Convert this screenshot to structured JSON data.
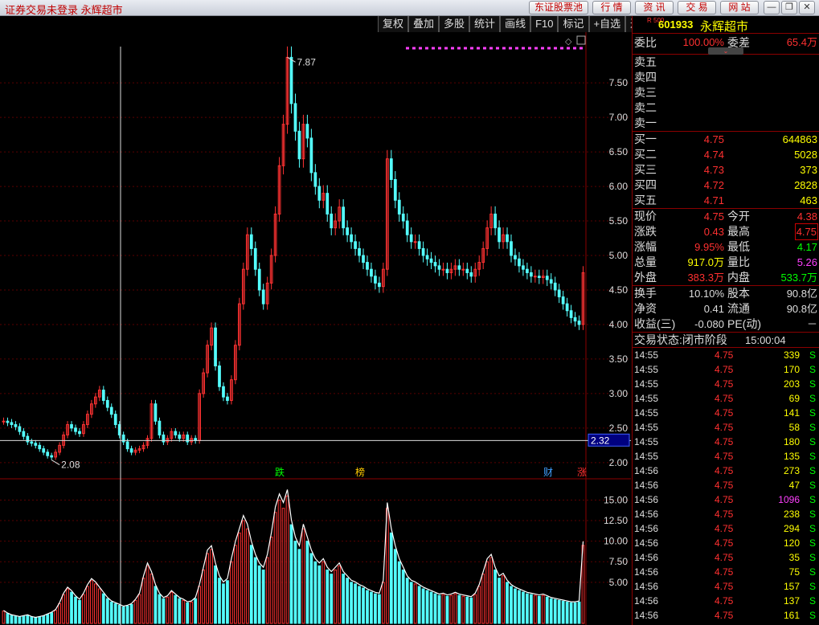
{
  "window": {
    "title": "证券交易未登录  永辉超市",
    "buttons": [
      "东证股票池",
      "行 情",
      "资 讯",
      "交 易",
      "网 站"
    ]
  },
  "toolbar": {
    "items": [
      "复权",
      "叠加",
      "多股",
      "统计",
      "画线",
      "F10",
      "标记",
      "+自选",
      "返回"
    ]
  },
  "chart": {
    "price_ticks": [
      "7.50",
      "7.00",
      "6.50",
      "6.00",
      "5.50",
      "5.00",
      "4.50",
      "4.00",
      "3.50",
      "3.00",
      "2.50",
      "2.00"
    ],
    "volume_ticks": [
      "15.00",
      "12.50",
      "10.00",
      "7.50",
      "5.00"
    ],
    "high_label": "7.87",
    "low_label": "2.08",
    "cursor_price": "2.32",
    "markers": [
      {
        "text": "跌",
        "color": "#00ff00"
      },
      {
        "text": "榜",
        "color": "#ffcc00"
      },
      {
        "text": "财",
        "color": "#40a0ff"
      },
      {
        "text": "涨",
        "color": "#ff3030"
      }
    ]
  },
  "chart_data": {
    "type": "candlestick",
    "ylim": [
      1.8,
      8.2
    ],
    "close": [
      2.6,
      2.58,
      2.55,
      2.52,
      2.45,
      2.38,
      2.3,
      2.28,
      2.25,
      2.2,
      2.15,
      2.1,
      2.08,
      2.15,
      2.25,
      2.4,
      2.55,
      2.5,
      2.45,
      2.42,
      2.55,
      2.7,
      2.85,
      2.95,
      3.05,
      2.9,
      2.8,
      2.7,
      2.55,
      2.4,
      2.3,
      2.2,
      2.15,
      2.18,
      2.2,
      2.25,
      2.35,
      2.85,
      2.6,
      2.4,
      2.3,
      2.35,
      2.45,
      2.4,
      2.35,
      2.4,
      2.3,
      2.35,
      2.32,
      3.0,
      3.3,
      3.7,
      3.95,
      3.4,
      3.1,
      2.95,
      2.9,
      3.2,
      3.7,
      4.3,
      4.8,
      5.3,
      5.1,
      4.8,
      4.5,
      4.3,
      4.6,
      5.0,
      5.6,
      6.3,
      6.9,
      7.87,
      7.2,
      6.8,
      6.4,
      6.9,
      6.7,
      6.2,
      6.0,
      5.8,
      5.9,
      5.6,
      5.4,
      5.5,
      5.7,
      5.4,
      5.3,
      5.2,
      5.1,
      5.0,
      4.9,
      4.8,
      4.7,
      4.6,
      4.55,
      4.8,
      6.4,
      6.1,
      5.8,
      5.6,
      5.5,
      5.3,
      5.2,
      5.2,
      5.1,
      5.0,
      4.95,
      4.9,
      4.85,
      4.8,
      4.8,
      4.75,
      4.8,
      4.85,
      4.8,
      4.8,
      4.75,
      4.7,
      4.8,
      4.9,
      5.1,
      5.4,
      5.6,
      5.4,
      5.2,
      5.3,
      5.2,
      5.0,
      4.95,
      4.85,
      4.8,
      4.75,
      4.7,
      4.7,
      4.68,
      4.7,
      4.65,
      4.6,
      4.5,
      4.4,
      4.3,
      4.2,
      4.1,
      4.05,
      4.0,
      4.75
    ],
    "volume": [
      1.5,
      1.2,
      1.0,
      0.9,
      0.8,
      0.9,
      1.0,
      0.8,
      0.7,
      0.8,
      0.9,
      1.1,
      1.3,
      1.6,
      2.4,
      3.5,
      4.2,
      3.8,
      3.2,
      2.8,
      3.5,
      4.5,
      5.2,
      4.8,
      4.2,
      3.6,
      3.0,
      2.6,
      2.4,
      2.2,
      2.0,
      2.1,
      2.3,
      2.8,
      3.5,
      5.5,
      7.0,
      6.0,
      4.5,
      3.5,
      3.0,
      3.2,
      3.8,
      3.4,
      3.0,
      2.8,
      2.5,
      2.6,
      3.0,
      4.5,
      6.5,
      8.5,
      9.0,
      7.0,
      5.5,
      4.8,
      5.2,
      7.5,
      9.5,
      11.0,
      12.5,
      11.5,
      9.5,
      8.0,
      7.0,
      6.5,
      8.0,
      10.5,
      13.5,
      15.0,
      14.0,
      15.5,
      12.0,
      10.0,
      9.0,
      11.5,
      10.0,
      8.5,
      7.5,
      7.0,
      7.5,
      6.5,
      6.0,
      6.5,
      7.0,
      6.0,
      5.5,
      5.0,
      4.8,
      4.5,
      4.3,
      4.0,
      3.8,
      3.6,
      3.5,
      5.0,
      14.0,
      11.0,
      9.0,
      7.5,
      6.5,
      5.5,
      5.0,
      4.8,
      4.5,
      4.2,
      4.0,
      3.8,
      3.6,
      3.4,
      3.5,
      3.3,
      3.4,
      3.6,
      3.4,
      3.3,
      3.2,
      3.1,
      3.5,
      4.5,
      6.0,
      7.5,
      8.0,
      6.5,
      5.5,
      5.8,
      5.0,
      4.5,
      4.2,
      4.0,
      3.8,
      3.6,
      3.5,
      3.4,
      3.3,
      3.4,
      3.2,
      3.0,
      2.9,
      2.8,
      2.7,
      2.6,
      2.5,
      2.5,
      2.6,
      9.5
    ],
    "volume_ylim": [
      0,
      17
    ]
  },
  "quote": {
    "code": "601933",
    "name": "永辉超市",
    "badge": "R 500",
    "weibi": {
      "label": "委比",
      "value": "100.00%",
      "label2": "委差",
      "value2": "65.4万"
    },
    "sells": [
      {
        "label": "卖五"
      },
      {
        "label": "卖四"
      },
      {
        "label": "卖三"
      },
      {
        "label": "卖二"
      },
      {
        "label": "卖一"
      }
    ],
    "buys": [
      {
        "label": "买一",
        "price": "4.75",
        "vol": "644863"
      },
      {
        "label": "买二",
        "price": "4.74",
        "vol": "5028"
      },
      {
        "label": "买三",
        "price": "4.73",
        "vol": "373"
      },
      {
        "label": "买四",
        "price": "4.72",
        "vol": "2828"
      },
      {
        "label": "买五",
        "price": "4.71",
        "vol": "463"
      }
    ],
    "stats": [
      {
        "l1": "现价",
        "v1": "4.75",
        "c1": "red",
        "l2": "今开",
        "v2": "4.38",
        "c2": "red"
      },
      {
        "l1": "涨跌",
        "v1": "0.43",
        "c1": "red",
        "l2": "最高",
        "v2": "4.75",
        "c2": "red"
      },
      {
        "l1": "涨幅",
        "v1": "9.95%",
        "c1": "red",
        "l2": "最低",
        "v2": "4.17",
        "c2": "grn"
      },
      {
        "l1": "总量",
        "v1": "917.0万",
        "c1": "yel",
        "l2": "量比",
        "v2": "5.26",
        "c2": "mag"
      },
      {
        "l1": "外盘",
        "v1": "383.3万",
        "c1": "red",
        "l2": "内盘",
        "v2": "533.7万",
        "c2": "grn"
      }
    ],
    "stats2": [
      {
        "l1": "换手",
        "v1": "10.10%",
        "l2": "股本",
        "v2": "90.8亿"
      },
      {
        "l1": "净资",
        "v1": "0.41",
        "l2": "流通",
        "v2": "90.8亿"
      },
      {
        "l1": "收益(三)",
        "v1": "-0.080",
        "l2": "PE(动)",
        "v2": "－"
      }
    ],
    "status_label": "交易状态:闭市阶段",
    "status_time": "15:00:04",
    "ticks": [
      {
        "t": "14:55",
        "p": "4.75",
        "v": "339",
        "c": "yel"
      },
      {
        "t": "14:55",
        "p": "4.75",
        "v": "170",
        "c": "yel"
      },
      {
        "t": "14:55",
        "p": "4.75",
        "v": "203",
        "c": "yel"
      },
      {
        "t": "14:55",
        "p": "4.75",
        "v": "69",
        "c": "yel"
      },
      {
        "t": "14:55",
        "p": "4.75",
        "v": "141",
        "c": "yel"
      },
      {
        "t": "14:55",
        "p": "4.75",
        "v": "58",
        "c": "yel"
      },
      {
        "t": "14:55",
        "p": "4.75",
        "v": "180",
        "c": "yel"
      },
      {
        "t": "14:55",
        "p": "4.75",
        "v": "135",
        "c": "yel"
      },
      {
        "t": "14:56",
        "p": "4.75",
        "v": "273",
        "c": "yel"
      },
      {
        "t": "14:56",
        "p": "4.75",
        "v": "47",
        "c": "yel"
      },
      {
        "t": "14:56",
        "p": "4.75",
        "v": "1096",
        "c": "mag"
      },
      {
        "t": "14:56",
        "p": "4.75",
        "v": "238",
        "c": "yel"
      },
      {
        "t": "14:56",
        "p": "4.75",
        "v": "294",
        "c": "yel"
      },
      {
        "t": "14:56",
        "p": "4.75",
        "v": "120",
        "c": "yel"
      },
      {
        "t": "14:56",
        "p": "4.75",
        "v": "35",
        "c": "yel"
      },
      {
        "t": "14:56",
        "p": "4.75",
        "v": "75",
        "c": "yel"
      },
      {
        "t": "14:56",
        "p": "4.75",
        "v": "157",
        "c": "yel"
      },
      {
        "t": "14:56",
        "p": "4.75",
        "v": "137",
        "c": "yel"
      },
      {
        "t": "14:56",
        "p": "4.75",
        "v": "161",
        "c": "yel"
      }
    ],
    "bs": "S"
  }
}
